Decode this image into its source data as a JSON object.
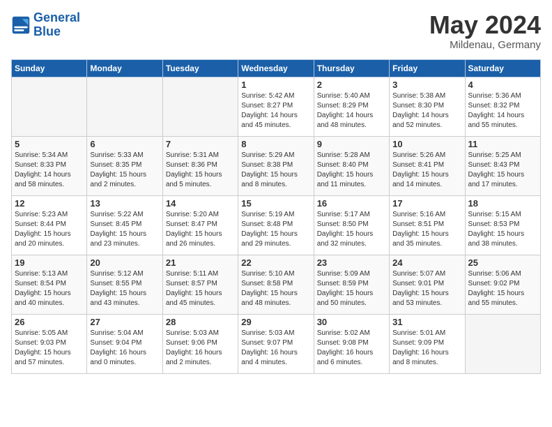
{
  "header": {
    "logo_line1": "General",
    "logo_line2": "Blue",
    "month": "May 2024",
    "location": "Mildenau, Germany"
  },
  "weekdays": [
    "Sunday",
    "Monday",
    "Tuesday",
    "Wednesday",
    "Thursday",
    "Friday",
    "Saturday"
  ],
  "weeks": [
    [
      {
        "day": "",
        "info": ""
      },
      {
        "day": "",
        "info": ""
      },
      {
        "day": "",
        "info": ""
      },
      {
        "day": "1",
        "info": "Sunrise: 5:42 AM\nSunset: 8:27 PM\nDaylight: 14 hours\nand 45 minutes."
      },
      {
        "day": "2",
        "info": "Sunrise: 5:40 AM\nSunset: 8:29 PM\nDaylight: 14 hours\nand 48 minutes."
      },
      {
        "day": "3",
        "info": "Sunrise: 5:38 AM\nSunset: 8:30 PM\nDaylight: 14 hours\nand 52 minutes."
      },
      {
        "day": "4",
        "info": "Sunrise: 5:36 AM\nSunset: 8:32 PM\nDaylight: 14 hours\nand 55 minutes."
      }
    ],
    [
      {
        "day": "5",
        "info": "Sunrise: 5:34 AM\nSunset: 8:33 PM\nDaylight: 14 hours\nand 58 minutes."
      },
      {
        "day": "6",
        "info": "Sunrise: 5:33 AM\nSunset: 8:35 PM\nDaylight: 15 hours\nand 2 minutes."
      },
      {
        "day": "7",
        "info": "Sunrise: 5:31 AM\nSunset: 8:36 PM\nDaylight: 15 hours\nand 5 minutes."
      },
      {
        "day": "8",
        "info": "Sunrise: 5:29 AM\nSunset: 8:38 PM\nDaylight: 15 hours\nand 8 minutes."
      },
      {
        "day": "9",
        "info": "Sunrise: 5:28 AM\nSunset: 8:40 PM\nDaylight: 15 hours\nand 11 minutes."
      },
      {
        "day": "10",
        "info": "Sunrise: 5:26 AM\nSunset: 8:41 PM\nDaylight: 15 hours\nand 14 minutes."
      },
      {
        "day": "11",
        "info": "Sunrise: 5:25 AM\nSunset: 8:43 PM\nDaylight: 15 hours\nand 17 minutes."
      }
    ],
    [
      {
        "day": "12",
        "info": "Sunrise: 5:23 AM\nSunset: 8:44 PM\nDaylight: 15 hours\nand 20 minutes."
      },
      {
        "day": "13",
        "info": "Sunrise: 5:22 AM\nSunset: 8:45 PM\nDaylight: 15 hours\nand 23 minutes."
      },
      {
        "day": "14",
        "info": "Sunrise: 5:20 AM\nSunset: 8:47 PM\nDaylight: 15 hours\nand 26 minutes."
      },
      {
        "day": "15",
        "info": "Sunrise: 5:19 AM\nSunset: 8:48 PM\nDaylight: 15 hours\nand 29 minutes."
      },
      {
        "day": "16",
        "info": "Sunrise: 5:17 AM\nSunset: 8:50 PM\nDaylight: 15 hours\nand 32 minutes."
      },
      {
        "day": "17",
        "info": "Sunrise: 5:16 AM\nSunset: 8:51 PM\nDaylight: 15 hours\nand 35 minutes."
      },
      {
        "day": "18",
        "info": "Sunrise: 5:15 AM\nSunset: 8:53 PM\nDaylight: 15 hours\nand 38 minutes."
      }
    ],
    [
      {
        "day": "19",
        "info": "Sunrise: 5:13 AM\nSunset: 8:54 PM\nDaylight: 15 hours\nand 40 minutes."
      },
      {
        "day": "20",
        "info": "Sunrise: 5:12 AM\nSunset: 8:55 PM\nDaylight: 15 hours\nand 43 minutes."
      },
      {
        "day": "21",
        "info": "Sunrise: 5:11 AM\nSunset: 8:57 PM\nDaylight: 15 hours\nand 45 minutes."
      },
      {
        "day": "22",
        "info": "Sunrise: 5:10 AM\nSunset: 8:58 PM\nDaylight: 15 hours\nand 48 minutes."
      },
      {
        "day": "23",
        "info": "Sunrise: 5:09 AM\nSunset: 8:59 PM\nDaylight: 15 hours\nand 50 minutes."
      },
      {
        "day": "24",
        "info": "Sunrise: 5:07 AM\nSunset: 9:01 PM\nDaylight: 15 hours\nand 53 minutes."
      },
      {
        "day": "25",
        "info": "Sunrise: 5:06 AM\nSunset: 9:02 PM\nDaylight: 15 hours\nand 55 minutes."
      }
    ],
    [
      {
        "day": "26",
        "info": "Sunrise: 5:05 AM\nSunset: 9:03 PM\nDaylight: 15 hours\nand 57 minutes."
      },
      {
        "day": "27",
        "info": "Sunrise: 5:04 AM\nSunset: 9:04 PM\nDaylight: 16 hours\nand 0 minutes."
      },
      {
        "day": "28",
        "info": "Sunrise: 5:03 AM\nSunset: 9:06 PM\nDaylight: 16 hours\nand 2 minutes."
      },
      {
        "day": "29",
        "info": "Sunrise: 5:03 AM\nSunset: 9:07 PM\nDaylight: 16 hours\nand 4 minutes."
      },
      {
        "day": "30",
        "info": "Sunrise: 5:02 AM\nSunset: 9:08 PM\nDaylight: 16 hours\nand 6 minutes."
      },
      {
        "day": "31",
        "info": "Sunrise: 5:01 AM\nSunset: 9:09 PM\nDaylight: 16 hours\nand 8 minutes."
      },
      {
        "day": "",
        "info": ""
      }
    ]
  ]
}
